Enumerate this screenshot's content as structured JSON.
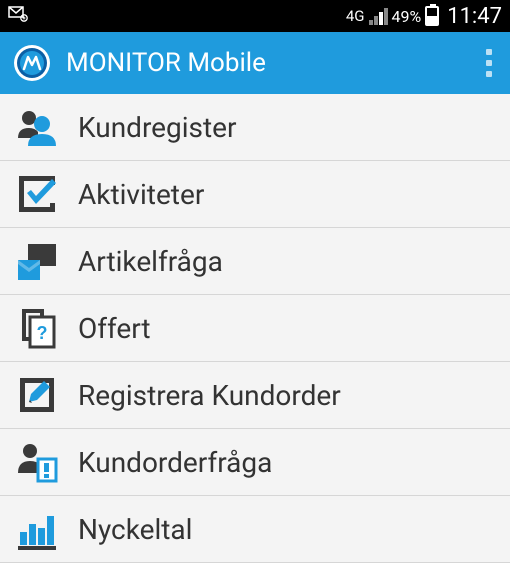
{
  "status": {
    "network": "4G",
    "battery_percent": "49%",
    "time": "11:47"
  },
  "app_bar": {
    "title": "MONITOR Mobile"
  },
  "menu": {
    "items": [
      {
        "label": "Kundregister",
        "icon": "users-icon"
      },
      {
        "label": "Aktiviteter",
        "icon": "check-icon"
      },
      {
        "label": "Artikelfråga",
        "icon": "article-icon"
      },
      {
        "label": "Offert",
        "icon": "offer-icon"
      },
      {
        "label": "Registrera Kundorder",
        "icon": "register-icon"
      },
      {
        "label": "Kundorderfråga",
        "icon": "order-query-icon"
      },
      {
        "label": "Nyckeltal",
        "icon": "bars-icon"
      }
    ]
  },
  "colors": {
    "accent": "#1f9bdd",
    "icon_blue": "#1f9bdd",
    "icon_dark": "#3a3a3a"
  }
}
